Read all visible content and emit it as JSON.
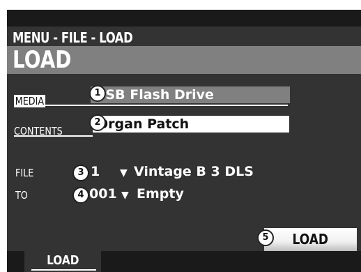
{
  "header": {
    "breadcrumb": "MENU - FILE - LOAD",
    "title": "LOAD"
  },
  "rows": {
    "media": {
      "label": "MEDIA",
      "badge": "1",
      "value": "USB Flash Drive"
    },
    "contents": {
      "label": "CONTENTS",
      "badge": "2",
      "value": "Organ Patch"
    },
    "file": {
      "label": "FILE",
      "badge": "3",
      "number": "1",
      "name": "Vintage  B 3  DLS"
    },
    "to": {
      "label": "TO",
      "badge": "4",
      "number": "001",
      "name": "Empty"
    }
  },
  "action": {
    "badge": "5",
    "load_label": "LOAD"
  },
  "footer": {
    "tab_label": "LOAD"
  },
  "icons": {
    "dropdown": "triangle-down-icon"
  },
  "colors": {
    "background": "#333333",
    "title_bar": "#808080",
    "highlight": "#ffffff"
  }
}
